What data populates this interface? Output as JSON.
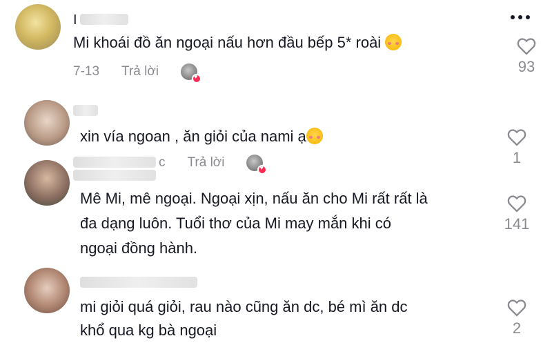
{
  "comments": [
    {
      "name_partial": "I",
      "text": "Mi khoái đồ ăn ngoại nấu hơn đầu bếp 5* roài",
      "date": "7-13",
      "reply": "Trả lời",
      "likes": "93"
    },
    {
      "text": "xin vía ngoan , ăn giỏi của nami ạ",
      "date_partial": "c",
      "reply": "Trả lời",
      "likes": "1"
    },
    {
      "lines": [
        "Mê Mi, mê ngoại. Ngoại xịn, nấu ăn cho Mi rất rất là",
        "đa dạng luôn. Tuổi thơ của Mi may mắn khi có",
        "ngoại đồng hành."
      ],
      "likes": "141"
    },
    {
      "lines": [
        "mi giỏi quá giỏi, rau nào cũng ăn dc, bé mì ăn dc",
        "khổ qua kg bà ngoại"
      ],
      "likes": "2"
    }
  ],
  "icons": {
    "more": "more-dots-icon",
    "like": "heart-outline-icon",
    "emoji": "smiling-face-with-hearts-emoji",
    "creator_liked": "creator-liked-badge"
  },
  "colors": {
    "text": "#161823",
    "muted": "#8a8b91",
    "like_badge": "#fe2c55"
  }
}
